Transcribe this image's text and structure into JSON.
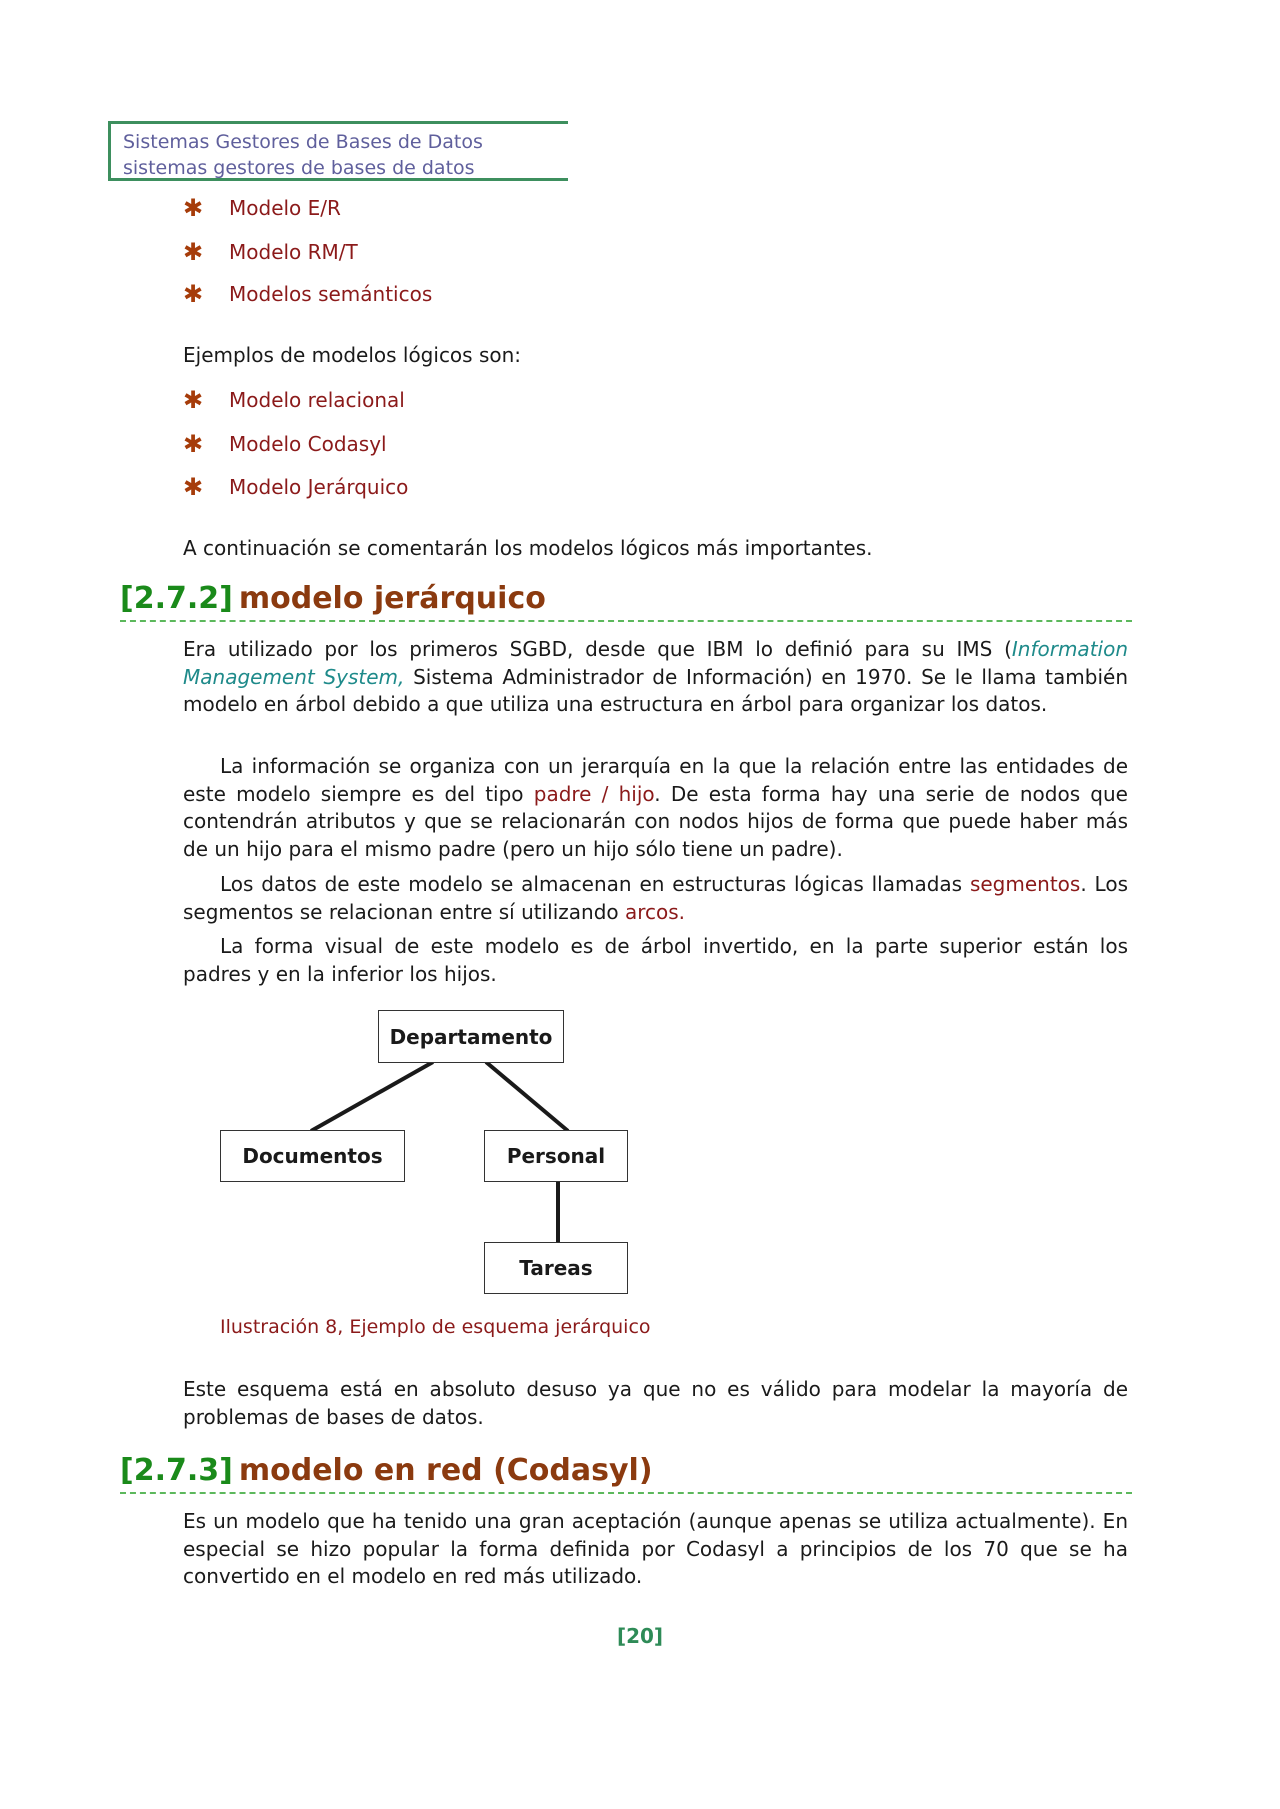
{
  "header": {
    "line1": "Sistemas Gestores de Bases de Datos",
    "line2": "sistemas gestores de bases de datos"
  },
  "conceptual_models": {
    "items": [
      {
        "icon": "asterisk-bullet-icon",
        "label": "Modelo E/R"
      },
      {
        "icon": "asterisk-bullet-icon",
        "label": "Modelo RM/T"
      },
      {
        "icon": "asterisk-bullet-icon",
        "label": "Modelos semánticos"
      }
    ]
  },
  "logical_intro": "Ejemplos de modelos lógicos son:",
  "logical_models": {
    "items": [
      {
        "icon": "asterisk-bullet-icon",
        "label": "Modelo relacional"
      },
      {
        "icon": "asterisk-bullet-icon",
        "label": "Modelo Codasyl"
      },
      {
        "icon": "asterisk-bullet-icon",
        "label": "Modelo Jerárquico"
      }
    ]
  },
  "continuation": "A continuación se comentarán los modelos lógicos más importantes.",
  "section_hierarchical": {
    "number": "[2.7.2]",
    "title": "modelo jerárquico",
    "p1": {
      "a": "Era utilizado por los primeros SGBD, desde que IBM lo definió para su IMS (",
      "em": "Information Management System,",
      "b": " Sistema Administrador de Información) en 1970. Se le llama también modelo en árbol debido a que utiliza una estructura en árbol para organizar los datos."
    },
    "p2": {
      "a": "La información se organiza con un jerarquía en la que la relación entre las entidades de este modelo siempre es del tipo ",
      "term": "padre / hijo",
      "b": ". De esta forma hay una serie de nodos que contendrán atributos y que se relacionarán con nodos hijos de forma que puede haber más de un hijo para el mismo padre (pero un hijo sólo tiene un padre)."
    },
    "p3": {
      "a": "Los datos de este modelo se almacenan en estructuras lógicas llamadas ",
      "term1": "segmentos",
      "b": ". Los segmentos se relacionan entre sí utilizando ",
      "term2": "arcos."
    },
    "p4": "La forma visual de este modelo es de árbol invertido, en la parte superior están los padres y en la inferior los hijos.",
    "diagram": {
      "nodes": {
        "root": "Departamento",
        "child_left": "Documentos",
        "child_right": "Personal",
        "grandchild": "Tareas"
      },
      "edges": [
        [
          "Departamento",
          "Documentos"
        ],
        [
          "Departamento",
          "Personal"
        ],
        [
          "Personal",
          "Tareas"
        ]
      ],
      "caption": "Ilustración 8, Ejemplo de esquema jerárquico"
    },
    "p5": "Este esquema está en absoluto desuso ya que no es válido para modelar la mayoría de problemas de bases de datos."
  },
  "section_network": {
    "number": "[2.7.3]",
    "title": "modelo en red (Codasyl)",
    "p1": "Es un modelo que ha tenido una gran aceptación (aunque apenas se utiliza actualmente). En especial se hizo popular la forma definida por Codasyl a principios de los 70 que se ha convertido en el modelo en red más utilizado."
  },
  "footer": {
    "page_number": "[20]"
  },
  "colors": {
    "header_border": "#3d8f5e",
    "header_text": "#5f5f9c",
    "bullet": "#a63c0a",
    "term": "#8b1a1a",
    "section_number": "#1a8a1a",
    "section_title": "#8b3a0f",
    "emphasis": "#1e8a8a",
    "page_number": "#2e8b57"
  }
}
